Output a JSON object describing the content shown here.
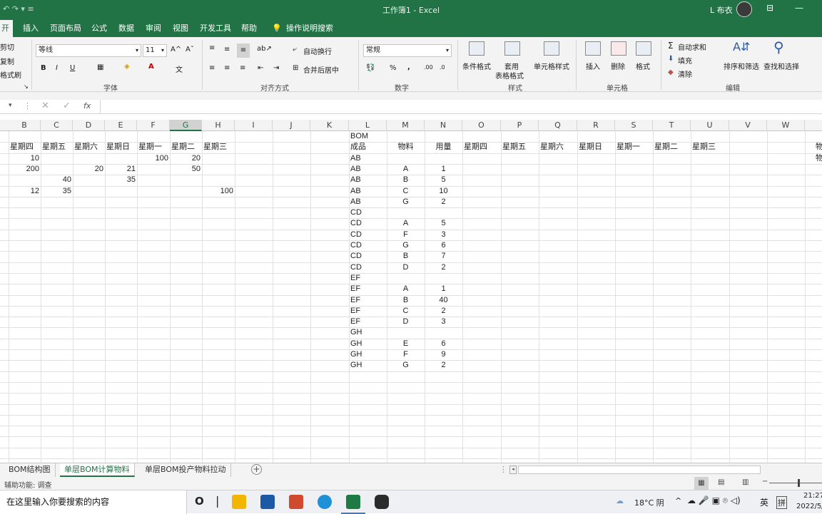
{
  "app": {
    "title": "工作簿1 - Excel",
    "user": "L 布衣",
    "window_buttons": [
      "⊟",
      "—"
    ]
  },
  "ribbon_tabs": [
    "开始",
    "插入",
    "页面布局",
    "公式",
    "数据",
    "审阅",
    "视图",
    "开发工具",
    "帮助",
    "操作说明搜索"
  ],
  "ribbon": {
    "clipboard": [
      "剪切",
      "复制",
      "格式刷"
    ],
    "font": {
      "name": "等线",
      "size": "11",
      "group": "字体",
      "bold": "B",
      "italic": "I",
      "underline": "U"
    },
    "align": {
      "wrap": "自动换行",
      "merge": "合并后居中",
      "group": "对齐方式"
    },
    "number": {
      "format": "常规",
      "group": "数字"
    },
    "styles": {
      "conditional": "条件格式",
      "table": "套用",
      "table2": "表格格式",
      "cell": "单元格样式",
      "group": "样式"
    },
    "cells": {
      "insert": "插入",
      "delete": "删除",
      "format": "格式",
      "group": "单元格"
    },
    "editing": {
      "autosum": "自动求和",
      "fill": "填充",
      "clear": "清除",
      "sort": "排序和筛选",
      "find": "查找和选择",
      "group": "编辑"
    }
  },
  "formula_bar": {
    "fx": "fx",
    "value": ""
  },
  "columns": [
    "B",
    "C",
    "D",
    "E",
    "F",
    "G",
    "H",
    "I",
    "J",
    "K",
    "L",
    "M",
    "N",
    "O",
    "P",
    "Q",
    "R",
    "S",
    "T",
    "U",
    "V",
    "W"
  ],
  "selected_column": "G",
  "left_table": {
    "headers": [
      "星期四",
      "星期五",
      "星期六",
      "星期日",
      "星期一",
      "星期二",
      "星期三"
    ],
    "rows": [
      [
        "10",
        "",
        "",
        "",
        "100",
        "20",
        ""
      ],
      [
        "200",
        "",
        "20",
        "21",
        "",
        "50",
        ""
      ],
      [
        "",
        "40",
        "",
        "35",
        "",
        "",
        ""
      ],
      [
        "12",
        "35",
        "",
        "",
        "",
        "",
        "100"
      ]
    ]
  },
  "bom_table": {
    "title": "BOM",
    "headers": [
      "成品",
      "物料",
      "用量"
    ],
    "rows": [
      [
        "AB",
        "",
        ""
      ],
      [
        "AB",
        "A",
        "1"
      ],
      [
        "AB",
        "B",
        "5"
      ],
      [
        "AB",
        "C",
        "10"
      ],
      [
        "AB",
        "G",
        "2"
      ],
      [
        "CD",
        "",
        ""
      ],
      [
        "CD",
        "A",
        "5"
      ],
      [
        "CD",
        "F",
        "3"
      ],
      [
        "CD",
        "G",
        "6"
      ],
      [
        "CD",
        "B",
        "7"
      ],
      [
        "CD",
        "D",
        "2"
      ],
      [
        "EF",
        "",
        ""
      ],
      [
        "EF",
        "A",
        "1"
      ],
      [
        "EF",
        "B",
        "40"
      ],
      [
        "EF",
        "C",
        "2"
      ],
      [
        "EF",
        "D",
        "3"
      ],
      [
        "GH",
        "",
        ""
      ],
      [
        "GH",
        "E",
        "6"
      ],
      [
        "GH",
        "F",
        "9"
      ],
      [
        "GH",
        "G",
        "2"
      ]
    ]
  },
  "right_headers": [
    "星期四",
    "星期五",
    "星期六",
    "星期日",
    "星期一",
    "星期二",
    "星期三"
  ],
  "edge_text": [
    "物",
    "物"
  ],
  "sheet_tabs": [
    "BOM结构图",
    "单层BOM计算物料",
    "单层BOM投产物料拉动"
  ],
  "active_sheet": 1,
  "status": {
    "accessibility": "辅助功能: 调查"
  },
  "taskbar": {
    "search_placeholder": "在这里输入你要搜索的内容",
    "weather": "18°C 阴",
    "ime": "英",
    "time": "21:27",
    "date": "2022/5/"
  }
}
